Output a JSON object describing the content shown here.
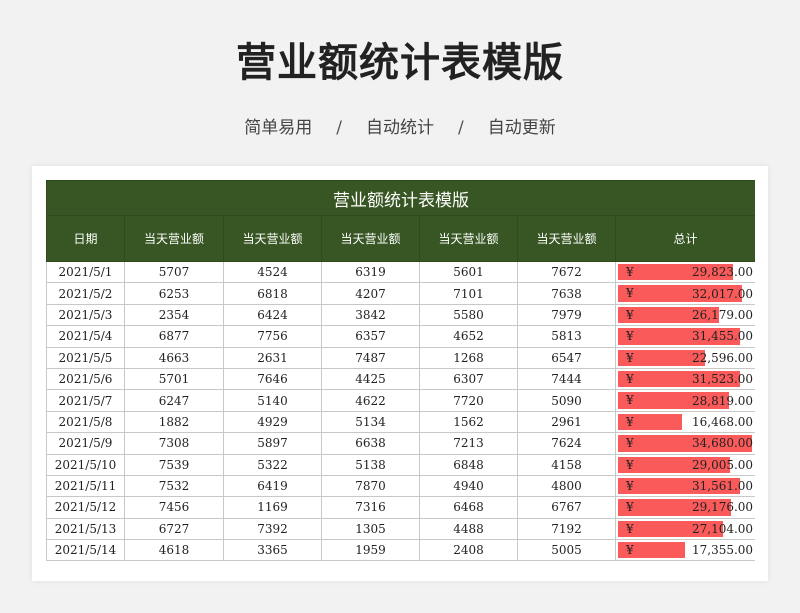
{
  "page": {
    "title": "营业额统计表模版",
    "tags": [
      "简单易用",
      "自动统计",
      "自动更新"
    ],
    "separator": "/"
  },
  "sheet": {
    "title": "营业额统计表模版",
    "headers": [
      "日期",
      "当天营业额",
      "当天营业额",
      "当天营业额",
      "当天营业额",
      "当天营业额",
      "总计"
    ],
    "currency_symbol": "¥",
    "bar_color": "#fa5a5a",
    "header_color": "#375623",
    "max_total": 34680,
    "rows": [
      {
        "date": "2021/5/1",
        "values": [
          "5707",
          "4524",
          "6319",
          "5601",
          "7672"
        ],
        "total": "29,823.00",
        "total_value": 29823
      },
      {
        "date": "2021/5/2",
        "values": [
          "6253",
          "6818",
          "4207",
          "7101",
          "7638"
        ],
        "total": "32,017.00",
        "total_value": 32017
      },
      {
        "date": "2021/5/3",
        "values": [
          "2354",
          "6424",
          "3842",
          "5580",
          "7979"
        ],
        "total": "26,179.00",
        "total_value": 26179
      },
      {
        "date": "2021/5/4",
        "values": [
          "6877",
          "7756",
          "6357",
          "4652",
          "5813"
        ],
        "total": "31,455.00",
        "total_value": 31455
      },
      {
        "date": "2021/5/5",
        "values": [
          "4663",
          "2631",
          "7487",
          "1268",
          "6547"
        ],
        "total": "22,596.00",
        "total_value": 22596
      },
      {
        "date": "2021/5/6",
        "values": [
          "5701",
          "7646",
          "4425",
          "6307",
          "7444"
        ],
        "total": "31,523.00",
        "total_value": 31523
      },
      {
        "date": "2021/5/7",
        "values": [
          "6247",
          "5140",
          "4622",
          "7720",
          "5090"
        ],
        "total": "28,819.00",
        "total_value": 28819
      },
      {
        "date": "2021/5/8",
        "values": [
          "1882",
          "4929",
          "5134",
          "1562",
          "2961"
        ],
        "total": "16,468.00",
        "total_value": 16468
      },
      {
        "date": "2021/5/9",
        "values": [
          "7308",
          "5897",
          "6638",
          "7213",
          "7624"
        ],
        "total": "34,680.00",
        "total_value": 34680
      },
      {
        "date": "2021/5/10",
        "values": [
          "7539",
          "5322",
          "5138",
          "6848",
          "4158"
        ],
        "total": "29,005.00",
        "total_value": 29005
      },
      {
        "date": "2021/5/11",
        "values": [
          "7532",
          "6419",
          "7870",
          "4940",
          "4800"
        ],
        "total": "31,561.00",
        "total_value": 31561
      },
      {
        "date": "2021/5/12",
        "values": [
          "7456",
          "1169",
          "7316",
          "6468",
          "6767"
        ],
        "total": "29,176.00",
        "total_value": 29176
      },
      {
        "date": "2021/5/13",
        "values": [
          "6727",
          "7392",
          "1305",
          "4488",
          "7192"
        ],
        "total": "27,104.00",
        "total_value": 27104
      },
      {
        "date": "2021/5/14",
        "values": [
          "4618",
          "3365",
          "1959",
          "2408",
          "5005"
        ],
        "total": "17,355.00",
        "total_value": 17355
      }
    ]
  }
}
